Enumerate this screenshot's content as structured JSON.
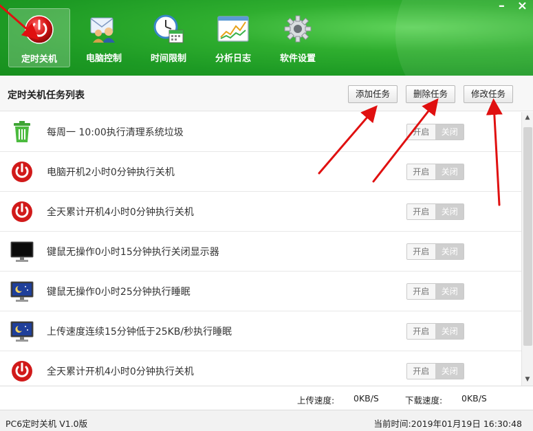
{
  "window": {
    "minimize_label": "–",
    "close_label": "×"
  },
  "nav": {
    "items": [
      {
        "label": "定时关机",
        "icon": "power-icon",
        "active": true
      },
      {
        "label": "电脑控制",
        "icon": "mail-users-icon",
        "active": false
      },
      {
        "label": "时间限制",
        "icon": "clock-calendar-icon",
        "active": false
      },
      {
        "label": "分析日志",
        "icon": "chart-icon",
        "active": false
      },
      {
        "label": "软件设置",
        "icon": "gear-icon",
        "active": false
      }
    ]
  },
  "header": {
    "title": "定时关机任务列表",
    "add_label": "添加任务",
    "delete_label": "删除任务",
    "edit_label": "修改任务"
  },
  "tasks": [
    {
      "text": "每周一 10:00执行清理系统垃圾",
      "icon": "trash-icon",
      "on_label": "开启",
      "off_label": "关闭"
    },
    {
      "text": "电脑开机2小时0分钟执行关机",
      "icon": "power-icon",
      "on_label": "开启",
      "off_label": "关闭"
    },
    {
      "text": "全天累计开机4小时0分钟执行关机",
      "icon": "power-icon",
      "on_label": "开启",
      "off_label": "关闭"
    },
    {
      "text": "键鼠无操作0小时15分钟执行关闭显示器",
      "icon": "monitor-off-icon",
      "on_label": "开启",
      "off_label": "关闭"
    },
    {
      "text": "键鼠无操作0小时25分钟执行睡眠",
      "icon": "monitor-sleep-icon",
      "on_label": "开启",
      "off_label": "关闭"
    },
    {
      "text": "上传速度连续15分钟低于25KB/秒执行睡眠",
      "icon": "monitor-sleep-icon",
      "on_label": "开启",
      "off_label": "关闭"
    },
    {
      "text": "全天累计开机4小时0分钟执行关机",
      "icon": "power-icon",
      "on_label": "开启",
      "off_label": "关闭"
    }
  ],
  "speed": {
    "upload_label": "上传速度:",
    "upload_value": "0KB/S",
    "download_label": "下载速度:",
    "download_value": "0KB/S"
  },
  "status": {
    "app_name": "PC6定时关机 V1.0版",
    "current_time": "当前时间:2019年01月19日 16:30:48"
  },
  "colors": {
    "brand_green": "#1d9a24",
    "power_red": "#d11a1a",
    "annotation_red": "#e01010"
  }
}
